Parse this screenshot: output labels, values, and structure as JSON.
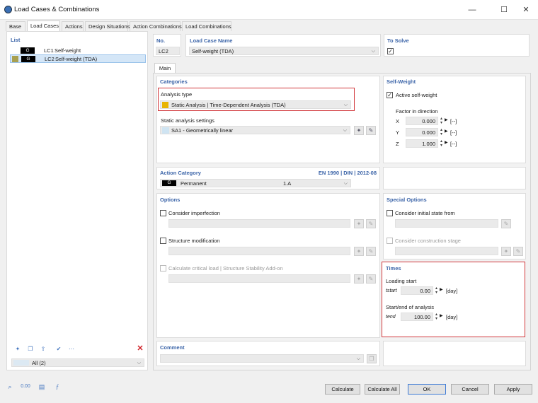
{
  "window": {
    "title": "Load Cases & Combinations",
    "minimize": "—",
    "maximize": "☐",
    "close": "✕"
  },
  "tabs": [
    "Base",
    "Load Cases",
    "Actions",
    "Design Situations",
    "Action Combinations",
    "Load Combinations"
  ],
  "list": {
    "title": "List",
    "items": [
      {
        "tag": "G",
        "id": "LC1",
        "name": "Self-weight",
        "color": "#000000"
      },
      {
        "tag": "G",
        "id": "LC2",
        "name": "Self-weight (TDA)",
        "color": "#000000",
        "marker_color": "#a8a050"
      }
    ],
    "filter": "All (2)"
  },
  "header": {
    "no_label": "No.",
    "no_value": "LC2",
    "name_label": "Load Case Name",
    "name_value": "Self-weight (TDA)",
    "solve_label": "To Solve"
  },
  "main_tab": "Main",
  "categories": {
    "title": "Categories",
    "analysis_type_label": "Analysis type",
    "analysis_type_value": "Static Analysis | Time-Dependent Analysis (TDA)",
    "analysis_color": "#e8b400",
    "static_settings_label": "Static analysis settings",
    "static_settings_value": "SA1 - Geometrically linear"
  },
  "self_weight": {
    "title": "Self-Weight",
    "active_label": "Active self-weight",
    "factor_label": "Factor in direction",
    "rows": [
      {
        "axis": "X",
        "value": "0.000",
        "unit": "[--]"
      },
      {
        "axis": "Y",
        "value": "0.000",
        "unit": "[--]"
      },
      {
        "axis": "Z",
        "value": "1.000",
        "unit": "[--]"
      }
    ]
  },
  "action_category": {
    "title": "Action Category",
    "standard": "EN 1990 | DIN | 2012-08",
    "tag": "G",
    "name": "Permanent",
    "code": "1.A"
  },
  "options": {
    "title": "Options",
    "imperfection": "Consider imperfection",
    "modification": "Structure modification",
    "critical": "Calculate critical load | Structure Stability Add-on"
  },
  "special": {
    "title": "Special Options",
    "initial": "Consider initial state from",
    "construction": "Consider construction stage"
  },
  "times": {
    "title": "Times",
    "loading_start_label": "Loading start",
    "tstart_sym": "tstart",
    "tstart_value": "0.00",
    "tstart_unit": "[day]",
    "startend_label": "Start/end of analysis",
    "tend_sym": "tend",
    "tend_value": "100.00",
    "tend_unit": "[day]"
  },
  "comment": {
    "title": "Comment"
  },
  "buttons": {
    "calculate": "Calculate",
    "calculate_all": "Calculate All",
    "ok": "OK",
    "cancel": "Cancel",
    "apply": "Apply"
  }
}
